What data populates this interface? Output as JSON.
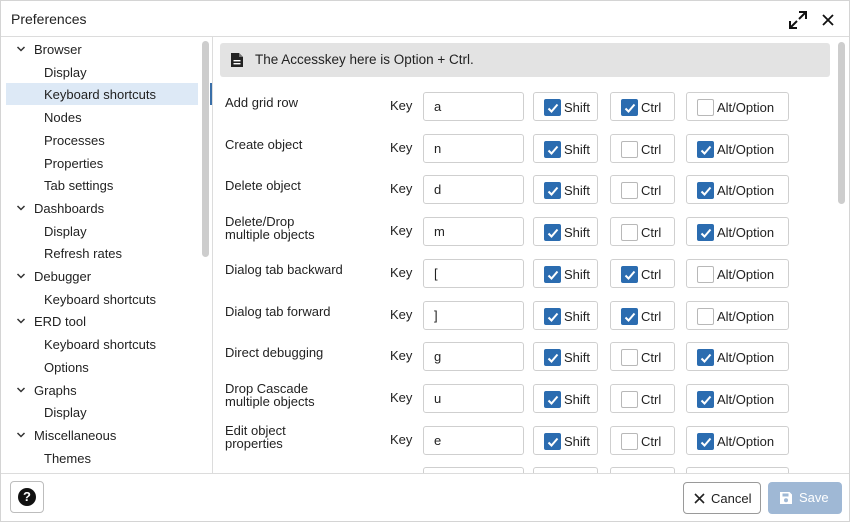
{
  "window": {
    "title": "Preferences"
  },
  "tree": {
    "items": [
      {
        "label": "Browser",
        "type": "parent"
      },
      {
        "label": "Display",
        "type": "child"
      },
      {
        "label": "Keyboard shortcuts",
        "type": "child",
        "selected": true
      },
      {
        "label": "Nodes",
        "type": "child"
      },
      {
        "label": "Processes",
        "type": "child"
      },
      {
        "label": "Properties",
        "type": "child"
      },
      {
        "label": "Tab settings",
        "type": "child"
      },
      {
        "label": "Dashboards",
        "type": "parent"
      },
      {
        "label": "Display",
        "type": "child"
      },
      {
        "label": "Refresh rates",
        "type": "child"
      },
      {
        "label": "Debugger",
        "type": "parent"
      },
      {
        "label": "Keyboard shortcuts",
        "type": "child"
      },
      {
        "label": "ERD tool",
        "type": "parent"
      },
      {
        "label": "Keyboard shortcuts",
        "type": "child"
      },
      {
        "label": "Options",
        "type": "child"
      },
      {
        "label": "Graphs",
        "type": "parent"
      },
      {
        "label": "Display",
        "type": "child"
      },
      {
        "label": "Miscellaneous",
        "type": "parent"
      },
      {
        "label": "Themes",
        "type": "child"
      }
    ]
  },
  "info": {
    "text": "The Accesskey here is Option + Ctrl.",
    "icon": "document-icon"
  },
  "labels": {
    "key": "Key",
    "shift": "Shift",
    "ctrl": "Ctrl",
    "alt": "Alt/Option"
  },
  "shortcuts": [
    {
      "name": "Add grid row",
      "key": "a",
      "shift": true,
      "ctrl": true,
      "alt": false
    },
    {
      "name": "Create object",
      "key": "n",
      "shift": true,
      "ctrl": false,
      "alt": true
    },
    {
      "name": "Delete object",
      "key": "d",
      "shift": true,
      "ctrl": false,
      "alt": true
    },
    {
      "name": "Delete/Drop\nmultiple objects",
      "key": "m",
      "shift": true,
      "ctrl": false,
      "alt": true
    },
    {
      "name": "Dialog tab backward",
      "key": "[",
      "shift": true,
      "ctrl": true,
      "alt": false
    },
    {
      "name": "Dialog tab forward",
      "key": "]",
      "shift": true,
      "ctrl": true,
      "alt": false
    },
    {
      "name": "Direct debugging",
      "key": "g",
      "shift": true,
      "ctrl": false,
      "alt": true
    },
    {
      "name": "Drop Cascade\nmultiple objects",
      "key": "u",
      "shift": true,
      "ctrl": false,
      "alt": true
    },
    {
      "name": "Edit object\nproperties",
      "key": "e",
      "shift": true,
      "ctrl": false,
      "alt": true
    }
  ],
  "footer": {
    "help_icon": "question-circle-icon",
    "cancel_label": "Cancel",
    "save_label": "Save"
  },
  "colors": {
    "accent": "#2b6cb0",
    "selected_bg": "#dde9f6",
    "save_disabled": "#9fb8d5",
    "banner_bg": "#e3e3e3"
  }
}
